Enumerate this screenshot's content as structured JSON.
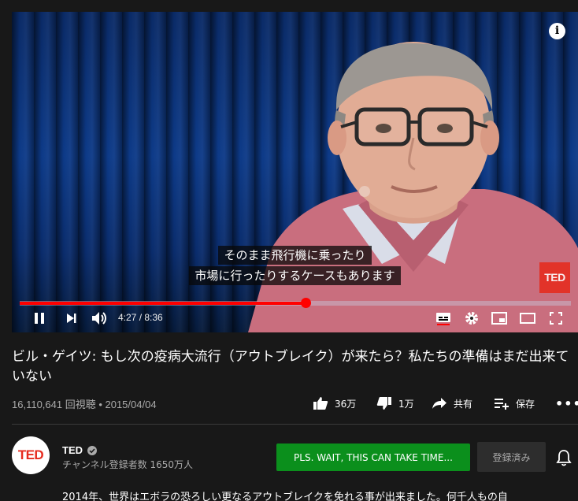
{
  "player": {
    "subtitle_line1": "そのまま飛行機に乗ったり",
    "subtitle_line2": "市場に行ったりするケースもあります",
    "watermark": "TED",
    "info_label": "i",
    "time_display": "4:27 / 8:36",
    "progress_fraction": 0.519
  },
  "video": {
    "title": "ビル・ゲイツ: もし次の疫病大流行（アウトブレイク）が来たら？私たちの準備はまだ出来ていない",
    "meta": "16,110,641 回視聴 • 2015/04/04"
  },
  "actions": {
    "like_count": "36万",
    "dislike_count": "1万",
    "share_label": "共有",
    "save_label": "保存",
    "more_label": "•••"
  },
  "channel": {
    "avatar_text": "TED",
    "name": "TED",
    "subscribers": "チャンネル登録者数 1650万人",
    "extension_button": "PLS. WAIT, THIS CAN TAKE TIME...",
    "subscribe_button": "登録済み"
  },
  "description": {
    "text": "2014年、世界はエボラの恐ろしい更なるアウトブレイクを免れる事が出来ました。何千人もの自"
  },
  "colors": {
    "background": "#181818",
    "progress": "#ff0000",
    "extension_green": "#0b8f1c",
    "ted_red": "#e62b1e"
  },
  "icons": [
    "pause-icon",
    "next-icon",
    "volume-icon",
    "subtitles-icon",
    "settings-icon",
    "miniplayer-icon",
    "theater-icon",
    "fullscreen-icon",
    "thumbs-up-icon",
    "thumbs-down-icon",
    "share-icon",
    "add-to-playlist-icon",
    "verified-icon",
    "bell-icon"
  ]
}
